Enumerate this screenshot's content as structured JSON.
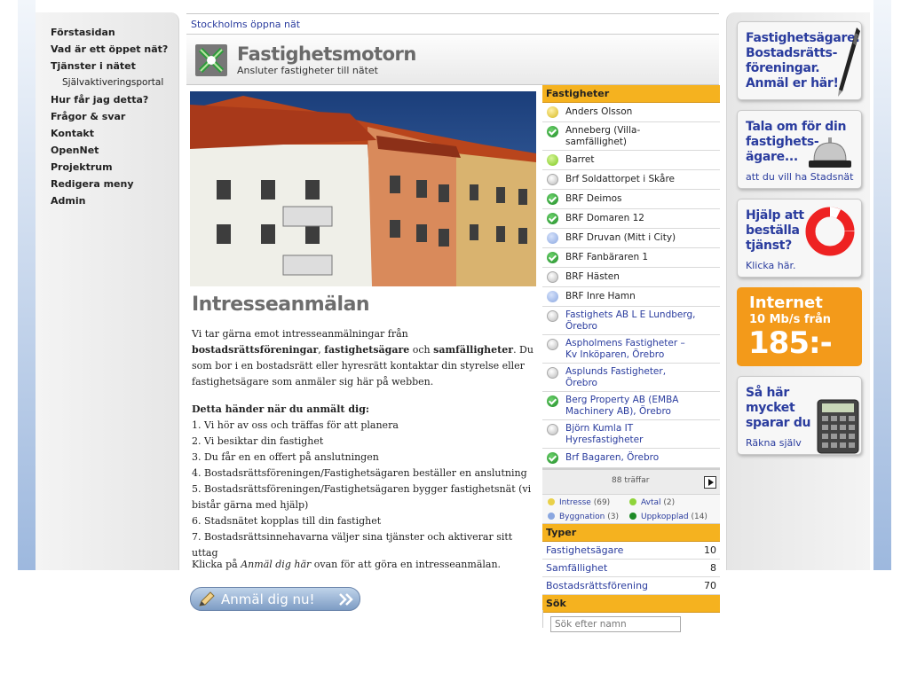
{
  "site_name": "Stockholms öppna nät",
  "logo": {
    "title": "Fastighetsmotorn",
    "tagline": "Ansluter fastigheter till nätet"
  },
  "nav": [
    {
      "label": "Förstasidan",
      "sub": false
    },
    {
      "label": "Vad är ett öppet nät?",
      "sub": false
    },
    {
      "label": "Tjänster i nätet",
      "sub": false
    },
    {
      "label": "Självaktiveringsportal",
      "sub": true
    },
    {
      "label": "Hur får jag detta?",
      "sub": false
    },
    {
      "label": "Frågor & svar",
      "sub": false
    },
    {
      "label": "Kontakt",
      "sub": false
    },
    {
      "label": "OpenNet",
      "sub": false
    },
    {
      "label": "Projektrum",
      "sub": false
    },
    {
      "label": "Redigera meny",
      "sub": false
    },
    {
      "label": "Admin",
      "sub": false
    }
  ],
  "main": {
    "heading": "Intresseanmälan",
    "intro": [
      {
        "t": "Vi tar gärna emot intresseanmälningar från ",
        "b": false
      },
      {
        "t": "bostadsrättsföreningar",
        "b": true
      },
      {
        "t": ", ",
        "b": false
      },
      {
        "t": "fastighetsägare",
        "b": true
      },
      {
        "t": " och ",
        "b": false
      },
      {
        "t": "samfälligheter",
        "b": true
      },
      {
        "t": ". Du som bor i en bostadsrätt eller hyresrätt kontaktar din styrelse eller fastighetsägare som anmäler sig här på webben.",
        "b": false
      }
    ],
    "steps_title": "Detta händer när du anmält dig:",
    "steps": [
      "1. Vi hör av oss och träffas för att planera",
      "2. Vi besiktar din fastighet",
      "3. Du får en en offert på anslutningen",
      "4. Bostadsrättsföreningen/Fastighetsägaren beställer en anslutning",
      "5. Bostadsrättsföreningen/Fastighetsägaren bygger fastighetsnät (vi bistår gärna med hjälp)",
      "6. Stadsnätet kopplas till din fastighet",
      "7. Bostadsrättsinnehavarna väljer sina tjänster och aktiverar sitt uttag"
    ],
    "closing_prefix": "Klicka på ",
    "closing_em": "Anmäl dig här",
    "closing_suffix": " ovan för att göra en intresseanmälan.",
    "cta_label": "Anmäl dig nu!"
  },
  "properties": {
    "heading": "Fastigheter",
    "items": [
      {
        "name": "Anders Olsson",
        "status": "yellow",
        "link": false
      },
      {
        "name": "Anneberg (Villa-\nsamfällighet)",
        "status": "check",
        "link": false
      },
      {
        "name": "Barret",
        "status": "green",
        "link": false
      },
      {
        "name": "Brf Soldattorpet i Skåre",
        "status": "gray",
        "link": false
      },
      {
        "name": "BRF Deimos",
        "status": "check",
        "link": false
      },
      {
        "name": "BRF Domaren 12",
        "status": "check",
        "link": false
      },
      {
        "name": "BRF Druvan (Mitt i City)",
        "status": "blue",
        "link": false
      },
      {
        "name": "BRF Fanbäraren 1",
        "status": "check",
        "link": false
      },
      {
        "name": "BRF Hästen",
        "status": "gray",
        "link": false
      },
      {
        "name": "BRF Inre Hamn",
        "status": "blue",
        "link": false
      },
      {
        "name": "Fastighets AB L E Lundberg,\nÖrebro",
        "status": "gray",
        "link": true
      },
      {
        "name": "Aspholmens Fastigheter –\nKv Inköparen, Örebro",
        "status": "gray",
        "link": true
      },
      {
        "name": "Asplunds Fastigheter,\nÖrebro",
        "status": "gray",
        "link": true
      },
      {
        "name": "Berg Property AB (EMBA\nMachinery AB), Örebro",
        "status": "check",
        "link": true
      },
      {
        "name": "Björn Kumla IT\nHyresfastigheter",
        "status": "gray",
        "link": true
      },
      {
        "name": "Brf Bagaren, Örebro",
        "status": "check",
        "link": true
      }
    ],
    "hits": "88 träffar",
    "legend": [
      {
        "label": "Intresse",
        "count": "(69)",
        "color": "#e9d14a"
      },
      {
        "label": "Avtal",
        "count": "(2)",
        "color": "#8fd43a"
      },
      {
        "label": "Byggnation",
        "count": "(3)",
        "color": "#8aa7e0"
      },
      {
        "label": "Uppkopplad",
        "count": "(14)",
        "color": "#1d8a25"
      }
    ]
  },
  "types": {
    "heading": "Typer",
    "items": [
      {
        "name": "Fastighetsägare",
        "count": "10"
      },
      {
        "name": "Samfällighet",
        "count": "8"
      },
      {
        "name": "Bostadsrättsförening",
        "count": "70"
      }
    ]
  },
  "search": {
    "heading": "Sök",
    "placeholder": "Sök efter namn"
  },
  "promos": {
    "owners": "Fastighetsägare.\nBostadsrätts-\nföreningar.\nAnmäl er här!",
    "tell_title": "Tala om för din\nfastighets-\nägare...",
    "tell_sub": "att du vill ha Stadsnät",
    "help_title": "Hjälp att\nbeställa\ntjänst?",
    "help_sub": "Klicka här.",
    "internet_title": "Internet",
    "internet_sub": "10 Mb/s från",
    "internet_price": "185:-",
    "save_title": "Så här\nmycket\nsparar du",
    "save_sub": "Räkna själv"
  },
  "colors": {
    "accent": "#f5b21f",
    "link": "#2a3c9e",
    "promo_orange": "#f39a1a"
  }
}
